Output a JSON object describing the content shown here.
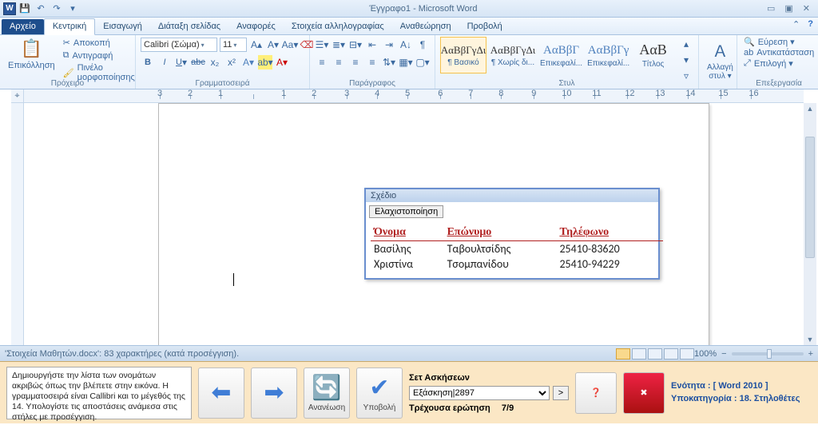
{
  "window": {
    "title": "Έγγραφο1 - Microsoft Word"
  },
  "tabs": {
    "file": "Αρχείο",
    "home": "Κεντρική",
    "insert": "Εισαγωγή",
    "layout": "Διάταξη σελίδας",
    "references": "Αναφορές",
    "mailings": "Στοιχεία αλληλογραφίας",
    "review": "Αναθεώρηση",
    "view": "Προβολή"
  },
  "ribbon": {
    "clipboard": {
      "paste": "Επικόλληση",
      "cut": "Αποκοπή",
      "copy": "Αντιγραφή",
      "format_painter": "Πινέλο μορφοποίησης",
      "label": "Πρόχειρο"
    },
    "font": {
      "name": "Calibri (Σώμα)",
      "size": "11",
      "label": "Γραμματοσειρά"
    },
    "paragraph": {
      "label": "Παράγραφος"
    },
    "styles": {
      "label": "Στυλ",
      "sample_text": "ΑαΒβΓγΔι",
      "sample_text_alt": "ΑαΒβΓ",
      "sample_text_alt2": "ΑαΒβΓγ",
      "sample_big": "ΑαΒ",
      "normal": "¶ Βασικό",
      "nospacing": "¶ Χωρίς δι...",
      "heading1": "Επικεφαλί...",
      "heading2": "Επικεφαλί...",
      "title": "Τίτλος",
      "change": "Αλλαγή στυλ ▾"
    },
    "editing": {
      "find": "Εύρεση ▾",
      "replace": "Αντικατάσταση",
      "select": "Επιλογή ▾",
      "label": "Επεξεργασία"
    }
  },
  "float": {
    "title": "Σχέδιο",
    "minimize": "Ελαχιστοποίηση",
    "headers": {
      "name": "Όνομα",
      "surname": "Επώνυμο",
      "phone": "Τηλέφωνο"
    },
    "rows": [
      {
        "name": "Βασίλης",
        "surname": "Ταβουλτσίδης",
        "phone": "25410-83620"
      },
      {
        "name": "Χριστίνα",
        "surname": "Τσομπανίδου",
        "phone": "25410-94229"
      }
    ]
  },
  "status": {
    "text": "'Στοιχεία Μαθητών.docx': 83 χαρακτήρες (κατά προσέγγιση).",
    "zoom": "100%"
  },
  "task": {
    "instructions": "Δημιουργήστε την λίστα των ονομάτων ακριβώς όπως την βλέπετε στην εικόνα. Η γραμματοσειρά είναι Callibri και το μέγεθός της 14. Υπολογίστε τις αποστάσεις ανάμεσα στις στήλες με προσέγγιση.",
    "refresh": "Ανανέωση",
    "submit": "Υποβολή",
    "set_label": "Σετ Ασκήσεων",
    "set_value": "Εξάσκηση|2897",
    "current_q_label": "Τρέχουσα ερώτηση",
    "current_q_value": "7/9",
    "unit_label": "Ενότητα : ",
    "unit_value": "[ Word 2010 ]",
    "sub_label": "Υποκατηγορία : ",
    "sub_value": "18. Στηλοθέτες"
  }
}
